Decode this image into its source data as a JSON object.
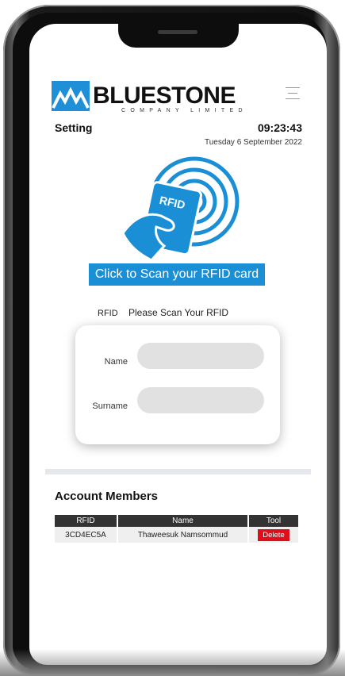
{
  "brand": {
    "name": "BLUESTONE",
    "subtitle": "COMPANY LIMITED",
    "accent": "#1b8fd6"
  },
  "header": {
    "title": "Setting",
    "time": "09:23:43",
    "date": "Tuesday 6 September 2022"
  },
  "scan": {
    "button_label": "Click to Scan your RFID card",
    "rfid_label": "RFID",
    "rfid_status": "Please Scan Your RFID",
    "card_label": "RFID"
  },
  "form": {
    "name_label": "Name",
    "surname_label": "Surname",
    "name_value": "",
    "surname_value": ""
  },
  "members": {
    "title": "Account Members",
    "columns": [
      "RFID",
      "Name",
      "Tool"
    ],
    "rows": [
      {
        "rfid": "3CD4EC5A",
        "name": "Thaweesuk Namsommud",
        "tool": "Delete"
      }
    ]
  },
  "colors": {
    "delete": "#e00d1a",
    "header_bg": "#333333"
  }
}
